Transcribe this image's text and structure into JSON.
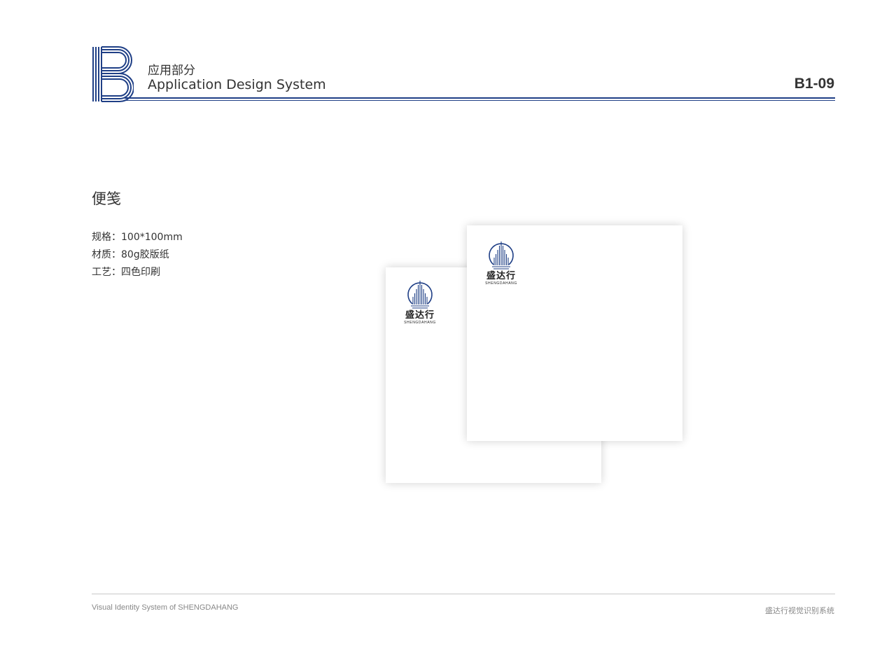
{
  "header": {
    "section_cn": "应用部分",
    "section_en": "Application Design System",
    "page_code": "B1-09",
    "accent_color": "#1f3f86"
  },
  "content": {
    "item_title": "便笺",
    "specs": [
      "规格：100*100mm",
      "材质：80g胶版纸",
      "工艺：四色印刷"
    ]
  },
  "brand_mark": {
    "name_cn": "盛达行",
    "name_en": "SHENGDAHANG",
    "icon": "building-circle-logo"
  },
  "footer": {
    "left_text": "Visual Identity System of SHENGDAHANG",
    "right_text": "盛达行视觉识别系统"
  }
}
